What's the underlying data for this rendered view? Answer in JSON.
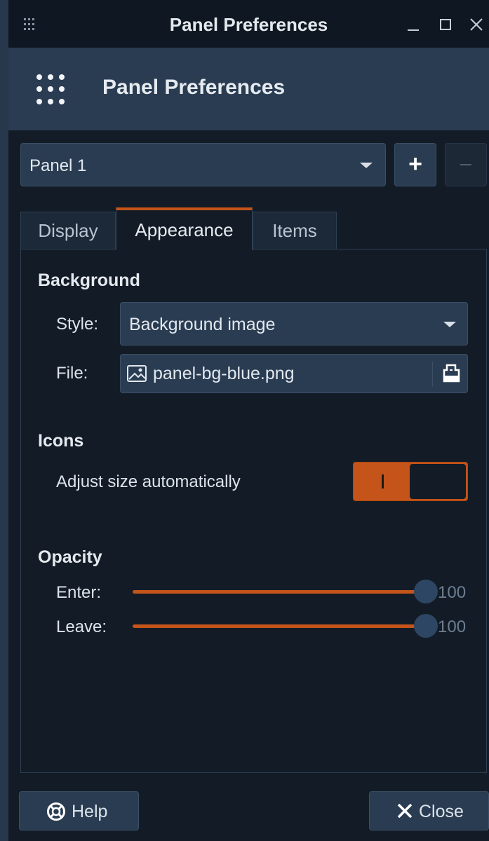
{
  "window": {
    "title": "Panel Preferences",
    "controls": [
      "minimize-icon",
      "maximize-icon",
      "close-icon"
    ]
  },
  "header": {
    "title": "Panel Preferences",
    "icon": "grid-dots-icon"
  },
  "panel_selector": {
    "value": "Panel 1",
    "add_label": "+"
  },
  "tabs": [
    {
      "label": "Display",
      "active": false
    },
    {
      "label": "Appearance",
      "active": true
    },
    {
      "label": "Items",
      "active": false
    }
  ],
  "background": {
    "section": "Background",
    "style_label": "Style:",
    "style_value": "Background image",
    "file_label": "File:",
    "file_value": "panel-bg-blue.png",
    "file_icon": "image-file-icon",
    "open_icon": "folder-open-icon"
  },
  "icons": {
    "section": "Icons",
    "adjust_label": "Adjust size automatically",
    "adjust_on": true
  },
  "opacity": {
    "section": "Opacity",
    "enter_label": "Enter:",
    "enter_value": "100",
    "leave_label": "Leave:",
    "leave_value": "100"
  },
  "footer": {
    "help_label": "Help",
    "close_label": "Close"
  },
  "colors": {
    "accent": "#c4541a",
    "window_bg": "#131c26",
    "header_bg": "#2a3c52"
  }
}
